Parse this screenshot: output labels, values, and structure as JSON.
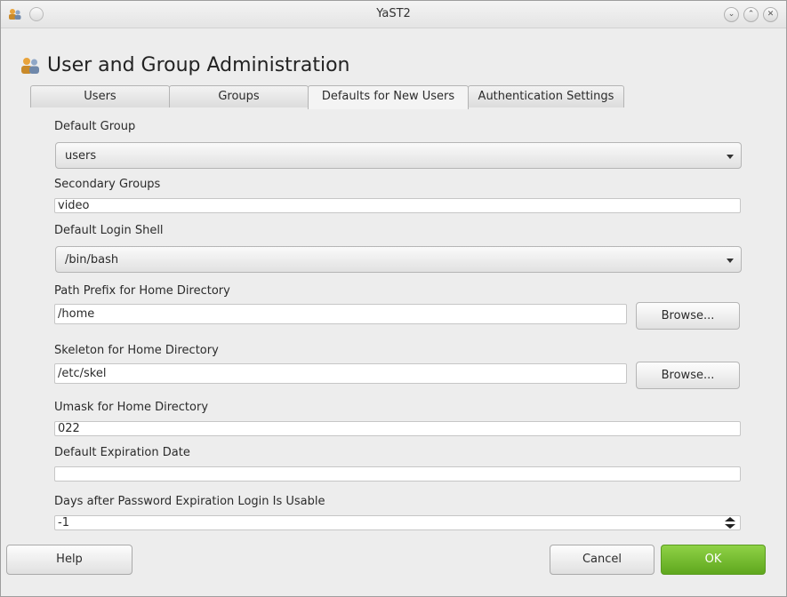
{
  "window": {
    "title": "YaST2"
  },
  "header": {
    "title": "User and Group Administration"
  },
  "tabs": [
    {
      "label": "Users"
    },
    {
      "label": "Groups"
    },
    {
      "label": "Defaults for New Users",
      "active": true
    },
    {
      "label": "Authentication Settings"
    }
  ],
  "form": {
    "default_group": {
      "label": "Default Group",
      "value": "users"
    },
    "secondary_groups": {
      "label": "Secondary Groups",
      "value": "video"
    },
    "default_login_shell": {
      "label": "Default Login Shell",
      "value": "/bin/bash"
    },
    "path_prefix": {
      "label": "Path Prefix for Home Directory",
      "value": "/home",
      "browse_label": "Browse..."
    },
    "skeleton": {
      "label": "Skeleton for Home Directory",
      "value": "/etc/skel",
      "browse_label": "Browse..."
    },
    "umask": {
      "label": "Umask for Home Directory",
      "value": "022"
    },
    "expiration_date": {
      "label": "Default Expiration Date",
      "value": ""
    },
    "days_after_expiration": {
      "label": "Days after Password Expiration Login Is Usable",
      "value": "-1"
    }
  },
  "footer": {
    "help_label": "Help",
    "cancel_label": "Cancel",
    "ok_label": "OK"
  },
  "colors": {
    "ok_button": "#6fba2c",
    "window_bg": "#ededed"
  }
}
